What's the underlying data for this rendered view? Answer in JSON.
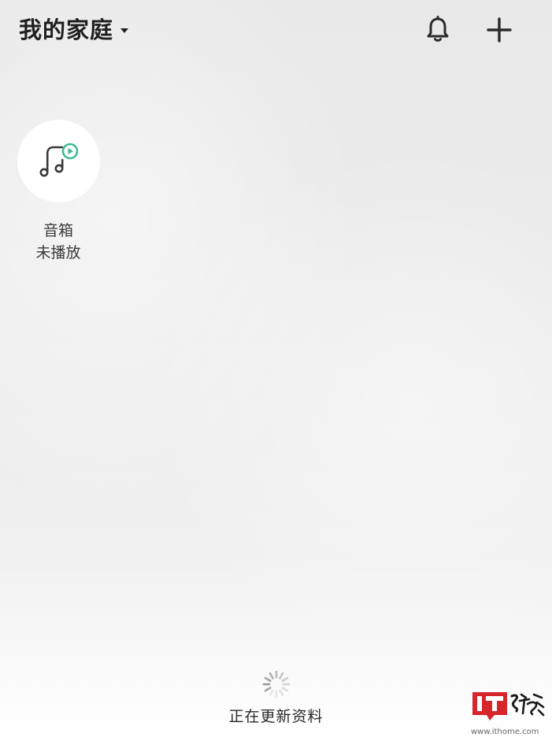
{
  "header": {
    "home_title": "我的家庭",
    "icons": {
      "home_dropdown": "caret-down-icon",
      "notifications": "bell-icon",
      "add": "plus-icon"
    }
  },
  "devices": [
    {
      "name": "音箱",
      "status": "未播放",
      "icon": "music-note-play-icon",
      "accent_color": "#3dbb94"
    }
  ],
  "loading": {
    "text": "正在更新资料",
    "icon": "spinner-icon"
  },
  "watermark": {
    "brand_text": "IT之家",
    "url": "www.ithome.com",
    "brand_color": "#d6262b"
  }
}
